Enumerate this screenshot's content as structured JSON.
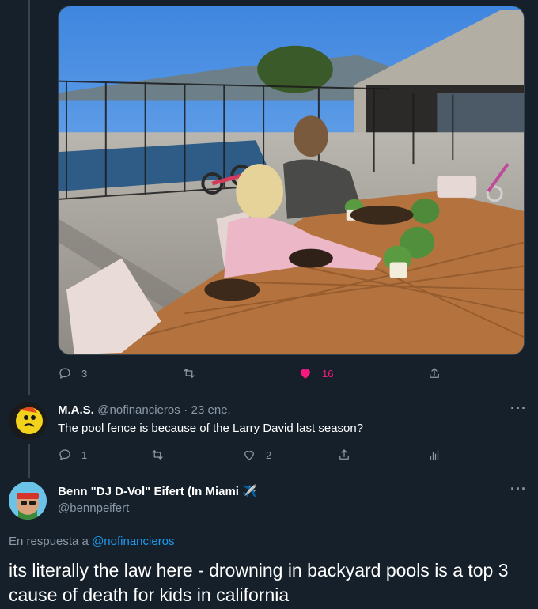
{
  "original_tweet": {
    "photo_alt": "",
    "actions": {
      "replies": "3",
      "retweets": "",
      "likes": "16"
    }
  },
  "reply": {
    "name": "M.A.S.",
    "handle": "@nofinancieros",
    "separator": "·",
    "date": "23 ene.",
    "text": "The pool fence is because of the Larry David last season?",
    "actions": {
      "replies": "1",
      "retweets": "",
      "likes": "2"
    }
  },
  "focused_tweet": {
    "name": "Benn \"DJ D-Vol\" Eifert (In Miami ✈️",
    "handle": "@bennpeifert",
    "reply_prefix": "En respuesta a",
    "reply_to": "@nofinancieros",
    "text": "its literally the law here - drowning in backyard pools is a top 3 cause of death for kids in california"
  },
  "colors": {
    "background": "#15202b",
    "secondary_text": "#8b98a5",
    "link": "#1d9bf0",
    "like": "#f91880",
    "thread_line": "#38444d"
  },
  "icons": [
    "reply-icon",
    "retweet-icon",
    "heart-icon",
    "share-icon",
    "analytics-icon",
    "more-icon",
    "airplane-emoji"
  ]
}
